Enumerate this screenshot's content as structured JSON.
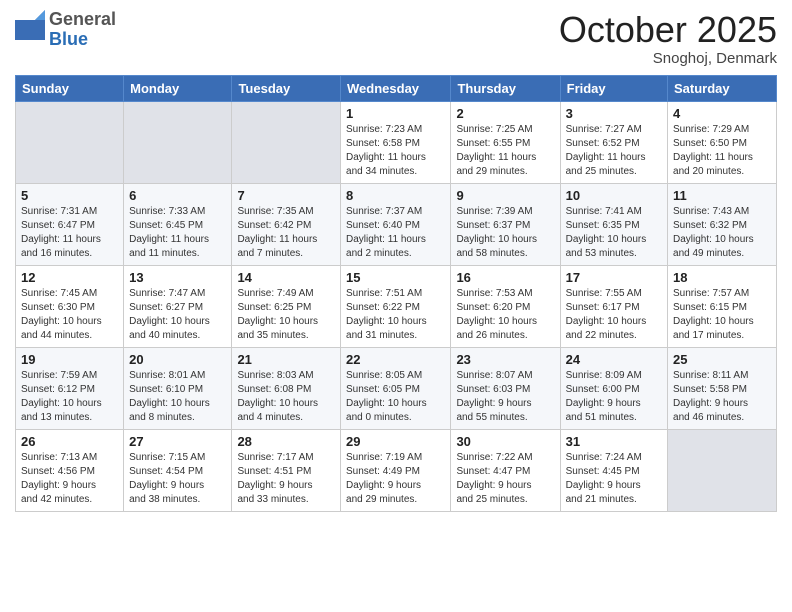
{
  "header": {
    "logo": {
      "general": "General",
      "blue": "Blue"
    },
    "title": "October 2025",
    "location": "Snoghoj, Denmark"
  },
  "weekdays": [
    "Sunday",
    "Monday",
    "Tuesday",
    "Wednesday",
    "Thursday",
    "Friday",
    "Saturday"
  ],
  "weeks": [
    [
      {
        "day": "",
        "detail": ""
      },
      {
        "day": "",
        "detail": ""
      },
      {
        "day": "",
        "detail": ""
      },
      {
        "day": "1",
        "detail": "Sunrise: 7:23 AM\nSunset: 6:58 PM\nDaylight: 11 hours\nand 34 minutes."
      },
      {
        "day": "2",
        "detail": "Sunrise: 7:25 AM\nSunset: 6:55 PM\nDaylight: 11 hours\nand 29 minutes."
      },
      {
        "day": "3",
        "detail": "Sunrise: 7:27 AM\nSunset: 6:52 PM\nDaylight: 11 hours\nand 25 minutes."
      },
      {
        "day": "4",
        "detail": "Sunrise: 7:29 AM\nSunset: 6:50 PM\nDaylight: 11 hours\nand 20 minutes."
      }
    ],
    [
      {
        "day": "5",
        "detail": "Sunrise: 7:31 AM\nSunset: 6:47 PM\nDaylight: 11 hours\nand 16 minutes."
      },
      {
        "day": "6",
        "detail": "Sunrise: 7:33 AM\nSunset: 6:45 PM\nDaylight: 11 hours\nand 11 minutes."
      },
      {
        "day": "7",
        "detail": "Sunrise: 7:35 AM\nSunset: 6:42 PM\nDaylight: 11 hours\nand 7 minutes."
      },
      {
        "day": "8",
        "detail": "Sunrise: 7:37 AM\nSunset: 6:40 PM\nDaylight: 11 hours\nand 2 minutes."
      },
      {
        "day": "9",
        "detail": "Sunrise: 7:39 AM\nSunset: 6:37 PM\nDaylight: 10 hours\nand 58 minutes."
      },
      {
        "day": "10",
        "detail": "Sunrise: 7:41 AM\nSunset: 6:35 PM\nDaylight: 10 hours\nand 53 minutes."
      },
      {
        "day": "11",
        "detail": "Sunrise: 7:43 AM\nSunset: 6:32 PM\nDaylight: 10 hours\nand 49 minutes."
      }
    ],
    [
      {
        "day": "12",
        "detail": "Sunrise: 7:45 AM\nSunset: 6:30 PM\nDaylight: 10 hours\nand 44 minutes."
      },
      {
        "day": "13",
        "detail": "Sunrise: 7:47 AM\nSunset: 6:27 PM\nDaylight: 10 hours\nand 40 minutes."
      },
      {
        "day": "14",
        "detail": "Sunrise: 7:49 AM\nSunset: 6:25 PM\nDaylight: 10 hours\nand 35 minutes."
      },
      {
        "day": "15",
        "detail": "Sunrise: 7:51 AM\nSunset: 6:22 PM\nDaylight: 10 hours\nand 31 minutes."
      },
      {
        "day": "16",
        "detail": "Sunrise: 7:53 AM\nSunset: 6:20 PM\nDaylight: 10 hours\nand 26 minutes."
      },
      {
        "day": "17",
        "detail": "Sunrise: 7:55 AM\nSunset: 6:17 PM\nDaylight: 10 hours\nand 22 minutes."
      },
      {
        "day": "18",
        "detail": "Sunrise: 7:57 AM\nSunset: 6:15 PM\nDaylight: 10 hours\nand 17 minutes."
      }
    ],
    [
      {
        "day": "19",
        "detail": "Sunrise: 7:59 AM\nSunset: 6:12 PM\nDaylight: 10 hours\nand 13 minutes."
      },
      {
        "day": "20",
        "detail": "Sunrise: 8:01 AM\nSunset: 6:10 PM\nDaylight: 10 hours\nand 8 minutes."
      },
      {
        "day": "21",
        "detail": "Sunrise: 8:03 AM\nSunset: 6:08 PM\nDaylight: 10 hours\nand 4 minutes."
      },
      {
        "day": "22",
        "detail": "Sunrise: 8:05 AM\nSunset: 6:05 PM\nDaylight: 10 hours\nand 0 minutes."
      },
      {
        "day": "23",
        "detail": "Sunrise: 8:07 AM\nSunset: 6:03 PM\nDaylight: 9 hours\nand 55 minutes."
      },
      {
        "day": "24",
        "detail": "Sunrise: 8:09 AM\nSunset: 6:00 PM\nDaylight: 9 hours\nand 51 minutes."
      },
      {
        "day": "25",
        "detail": "Sunrise: 8:11 AM\nSunset: 5:58 PM\nDaylight: 9 hours\nand 46 minutes."
      }
    ],
    [
      {
        "day": "26",
        "detail": "Sunrise: 7:13 AM\nSunset: 4:56 PM\nDaylight: 9 hours\nand 42 minutes."
      },
      {
        "day": "27",
        "detail": "Sunrise: 7:15 AM\nSunset: 4:54 PM\nDaylight: 9 hours\nand 38 minutes."
      },
      {
        "day": "28",
        "detail": "Sunrise: 7:17 AM\nSunset: 4:51 PM\nDaylight: 9 hours\nand 33 minutes."
      },
      {
        "day": "29",
        "detail": "Sunrise: 7:19 AM\nSunset: 4:49 PM\nDaylight: 9 hours\nand 29 minutes."
      },
      {
        "day": "30",
        "detail": "Sunrise: 7:22 AM\nSunset: 4:47 PM\nDaylight: 9 hours\nand 25 minutes."
      },
      {
        "day": "31",
        "detail": "Sunrise: 7:24 AM\nSunset: 4:45 PM\nDaylight: 9 hours\nand 21 minutes."
      },
      {
        "day": "",
        "detail": ""
      }
    ]
  ]
}
